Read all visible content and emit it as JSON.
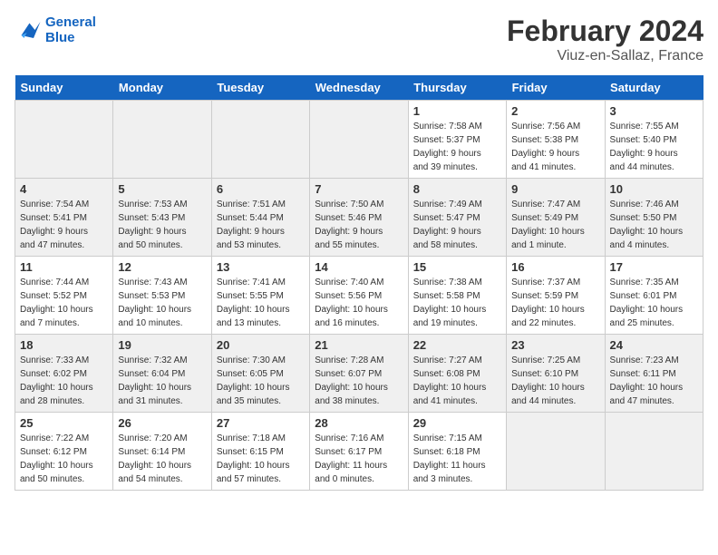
{
  "header": {
    "logo_line1": "General",
    "logo_line2": "Blue",
    "month": "February 2024",
    "location": "Viuz-en-Sallaz, France"
  },
  "weekdays": [
    "Sunday",
    "Monday",
    "Tuesday",
    "Wednesday",
    "Thursday",
    "Friday",
    "Saturday"
  ],
  "weeks": [
    [
      {
        "day": "",
        "info": ""
      },
      {
        "day": "",
        "info": ""
      },
      {
        "day": "",
        "info": ""
      },
      {
        "day": "",
        "info": ""
      },
      {
        "day": "1",
        "info": "Sunrise: 7:58 AM\nSunset: 5:37 PM\nDaylight: 9 hours\nand 39 minutes."
      },
      {
        "day": "2",
        "info": "Sunrise: 7:56 AM\nSunset: 5:38 PM\nDaylight: 9 hours\nand 41 minutes."
      },
      {
        "day": "3",
        "info": "Sunrise: 7:55 AM\nSunset: 5:40 PM\nDaylight: 9 hours\nand 44 minutes."
      }
    ],
    [
      {
        "day": "4",
        "info": "Sunrise: 7:54 AM\nSunset: 5:41 PM\nDaylight: 9 hours\nand 47 minutes."
      },
      {
        "day": "5",
        "info": "Sunrise: 7:53 AM\nSunset: 5:43 PM\nDaylight: 9 hours\nand 50 minutes."
      },
      {
        "day": "6",
        "info": "Sunrise: 7:51 AM\nSunset: 5:44 PM\nDaylight: 9 hours\nand 53 minutes."
      },
      {
        "day": "7",
        "info": "Sunrise: 7:50 AM\nSunset: 5:46 PM\nDaylight: 9 hours\nand 55 minutes."
      },
      {
        "day": "8",
        "info": "Sunrise: 7:49 AM\nSunset: 5:47 PM\nDaylight: 9 hours\nand 58 minutes."
      },
      {
        "day": "9",
        "info": "Sunrise: 7:47 AM\nSunset: 5:49 PM\nDaylight: 10 hours\nand 1 minute."
      },
      {
        "day": "10",
        "info": "Sunrise: 7:46 AM\nSunset: 5:50 PM\nDaylight: 10 hours\nand 4 minutes."
      }
    ],
    [
      {
        "day": "11",
        "info": "Sunrise: 7:44 AM\nSunset: 5:52 PM\nDaylight: 10 hours\nand 7 minutes."
      },
      {
        "day": "12",
        "info": "Sunrise: 7:43 AM\nSunset: 5:53 PM\nDaylight: 10 hours\nand 10 minutes."
      },
      {
        "day": "13",
        "info": "Sunrise: 7:41 AM\nSunset: 5:55 PM\nDaylight: 10 hours\nand 13 minutes."
      },
      {
        "day": "14",
        "info": "Sunrise: 7:40 AM\nSunset: 5:56 PM\nDaylight: 10 hours\nand 16 minutes."
      },
      {
        "day": "15",
        "info": "Sunrise: 7:38 AM\nSunset: 5:58 PM\nDaylight: 10 hours\nand 19 minutes."
      },
      {
        "day": "16",
        "info": "Sunrise: 7:37 AM\nSunset: 5:59 PM\nDaylight: 10 hours\nand 22 minutes."
      },
      {
        "day": "17",
        "info": "Sunrise: 7:35 AM\nSunset: 6:01 PM\nDaylight: 10 hours\nand 25 minutes."
      }
    ],
    [
      {
        "day": "18",
        "info": "Sunrise: 7:33 AM\nSunset: 6:02 PM\nDaylight: 10 hours\nand 28 minutes."
      },
      {
        "day": "19",
        "info": "Sunrise: 7:32 AM\nSunset: 6:04 PM\nDaylight: 10 hours\nand 31 minutes."
      },
      {
        "day": "20",
        "info": "Sunrise: 7:30 AM\nSunset: 6:05 PM\nDaylight: 10 hours\nand 35 minutes."
      },
      {
        "day": "21",
        "info": "Sunrise: 7:28 AM\nSunset: 6:07 PM\nDaylight: 10 hours\nand 38 minutes."
      },
      {
        "day": "22",
        "info": "Sunrise: 7:27 AM\nSunset: 6:08 PM\nDaylight: 10 hours\nand 41 minutes."
      },
      {
        "day": "23",
        "info": "Sunrise: 7:25 AM\nSunset: 6:10 PM\nDaylight: 10 hours\nand 44 minutes."
      },
      {
        "day": "24",
        "info": "Sunrise: 7:23 AM\nSunset: 6:11 PM\nDaylight: 10 hours\nand 47 minutes."
      }
    ],
    [
      {
        "day": "25",
        "info": "Sunrise: 7:22 AM\nSunset: 6:12 PM\nDaylight: 10 hours\nand 50 minutes."
      },
      {
        "day": "26",
        "info": "Sunrise: 7:20 AM\nSunset: 6:14 PM\nDaylight: 10 hours\nand 54 minutes."
      },
      {
        "day": "27",
        "info": "Sunrise: 7:18 AM\nSunset: 6:15 PM\nDaylight: 10 hours\nand 57 minutes."
      },
      {
        "day": "28",
        "info": "Sunrise: 7:16 AM\nSunset: 6:17 PM\nDaylight: 11 hours\nand 0 minutes."
      },
      {
        "day": "29",
        "info": "Sunrise: 7:15 AM\nSunset: 6:18 PM\nDaylight: 11 hours\nand 3 minutes."
      },
      {
        "day": "",
        "info": ""
      },
      {
        "day": "",
        "info": ""
      }
    ]
  ]
}
